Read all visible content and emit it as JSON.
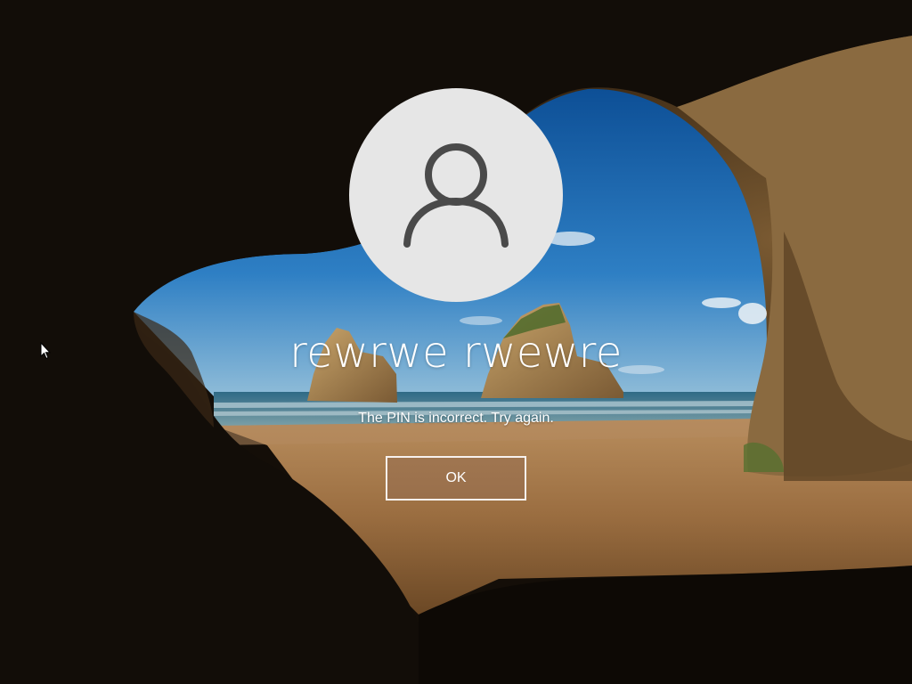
{
  "lock_screen": {
    "user_name": "rewrwe rwewre",
    "error_message": "The PIN is incorrect. Try again.",
    "ok_label": "OK",
    "avatar_icon": "user-icon",
    "cursor_icon": "mouse-pointer-icon"
  },
  "colors": {
    "avatar_background": "#e6e6e6",
    "avatar_glyph": "#4a4a4a",
    "text": "#ffffff",
    "sky": "#1f6fb8",
    "sand": "#a97a4a",
    "cave_rock": "#120d08"
  }
}
